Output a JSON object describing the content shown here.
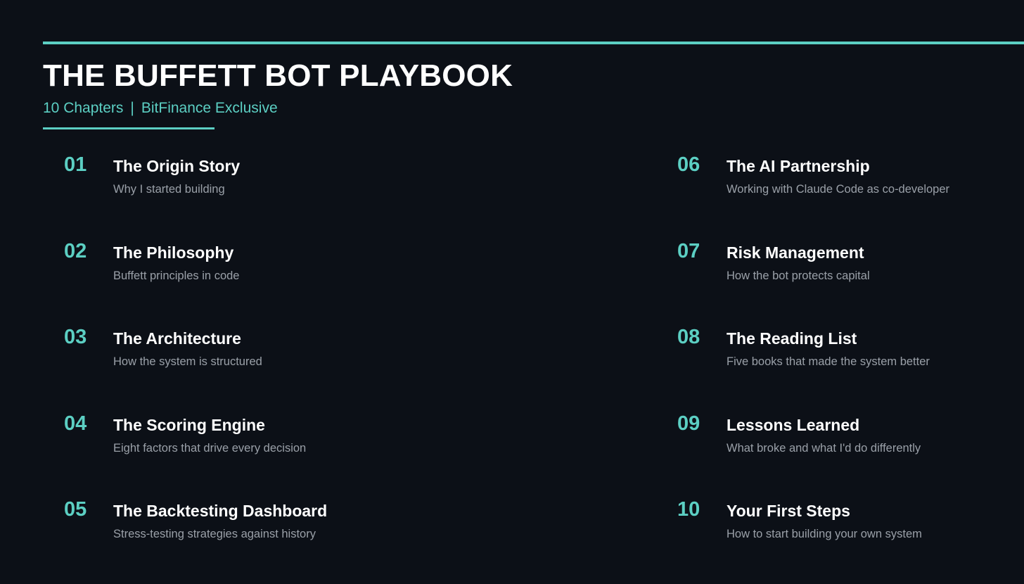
{
  "header": {
    "title": "THE BUFFETT BOT PLAYBOOK",
    "subtitle_left": "10 Chapters",
    "subtitle_sep": "|",
    "subtitle_right": "BitFinance Exclusive"
  },
  "colors": {
    "background": "#0c1017",
    "accent": "#5ccfc3",
    "title": "#ffffff",
    "description": "#9aa0a8"
  },
  "chapters_left": [
    {
      "number": "01",
      "title": "The Origin Story",
      "description": "Why I started building"
    },
    {
      "number": "02",
      "title": "The Philosophy",
      "description": "Buffett principles in code"
    },
    {
      "number": "03",
      "title": "The Architecture",
      "description": "How the system is structured"
    },
    {
      "number": "04",
      "title": "The Scoring Engine",
      "description": "Eight factors that drive every decision"
    },
    {
      "number": "05",
      "title": "The Backtesting Dashboard",
      "description": "Stress-testing strategies against history"
    }
  ],
  "chapters_right": [
    {
      "number": "06",
      "title": "The AI Partnership",
      "description": "Working with Claude Code as co-developer"
    },
    {
      "number": "07",
      "title": "Risk Management",
      "description": "How the bot protects capital"
    },
    {
      "number": "08",
      "title": "The Reading List",
      "description": "Five books that made the system better"
    },
    {
      "number": "09",
      "title": "Lessons Learned",
      "description": "What broke and what I'd do differently"
    },
    {
      "number": "10",
      "title": "Your First Steps",
      "description": "How to start building your own system"
    }
  ]
}
